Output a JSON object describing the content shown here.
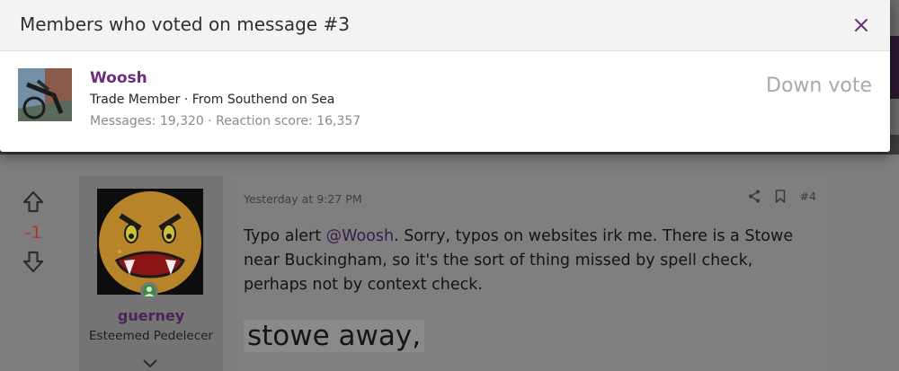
{
  "modal": {
    "title": "Members who voted on message #3",
    "close_icon": "close-icon"
  },
  "voter": {
    "name": "Woosh",
    "title_line": "Trade Member · From Southend on Sea",
    "stats_line": "Messages: 19,320 · Reaction score: 16,357",
    "reaction": "Down vote"
  },
  "post": {
    "vote_score": "-1",
    "author": "guerney",
    "author_title": "Esteemed Pedelecer",
    "date": "Yesterday at 9:27 PM",
    "number": "#4",
    "body_before": "Typo alert ",
    "mention": "@Woosh",
    "body_after": ". Sorry, typos on websites irk me. There is a Stowe near Buckingham, so it's the sort of thing missed by spell check, perhaps not by context check.",
    "quote": "stowe away,"
  },
  "colors": {
    "accent": "#6a2e7c",
    "downvote_score": "#b0332e",
    "online": "#3f8a3f"
  }
}
